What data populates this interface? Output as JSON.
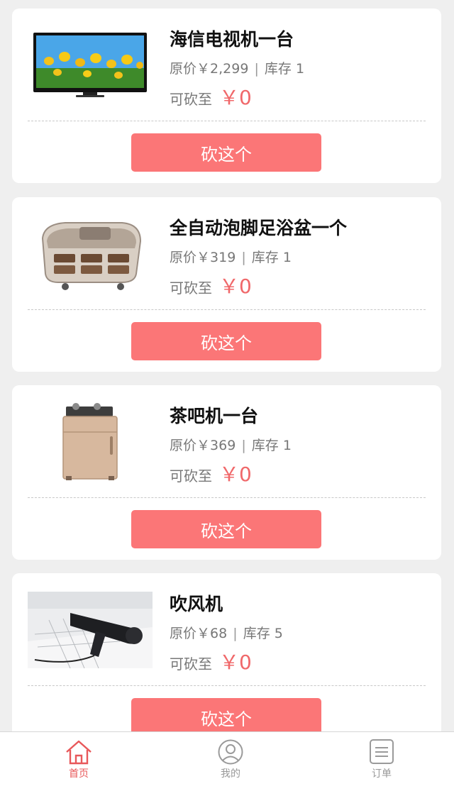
{
  "products": [
    {
      "title": "海信电视机一台",
      "original_label": "原价",
      "original_price": "￥2,299",
      "stock_label": "库存",
      "stock": "1",
      "cut_label": "可砍至",
      "cut_price": "￥0",
      "button": "砍这个",
      "image": "television-image"
    },
    {
      "title": "全自动泡脚足浴盆一个",
      "original_label": "原价",
      "original_price": "￥319",
      "stock_label": "库存",
      "stock": "1",
      "cut_label": "可砍至",
      "cut_price": "￥0",
      "button": "砍这个",
      "image": "foot-bath-image"
    },
    {
      "title": "茶吧机一台",
      "original_label": "原价",
      "original_price": "￥369",
      "stock_label": "库存",
      "stock": "1",
      "cut_label": "可砍至",
      "cut_price": "￥0",
      "button": "砍这个",
      "image": "tea-bar-machine-image"
    },
    {
      "title": "吹风机",
      "original_label": "原价",
      "original_price": "￥68",
      "stock_label": "库存",
      "stock": "5",
      "cut_label": "可砍至",
      "cut_price": "￥0",
      "button": "砍这个",
      "image": "hair-dryer-image"
    }
  ],
  "tabbar": {
    "items": [
      {
        "label": "首页",
        "icon": "home-icon",
        "active": true
      },
      {
        "label": "我的",
        "icon": "user-icon",
        "active": false
      },
      {
        "label": "订单",
        "icon": "order-list-icon",
        "active": false
      }
    ]
  },
  "colors": {
    "accent": "#fb7677",
    "price": "#f0686a",
    "active_tab": "#e8585a",
    "background": "#efefef"
  }
}
